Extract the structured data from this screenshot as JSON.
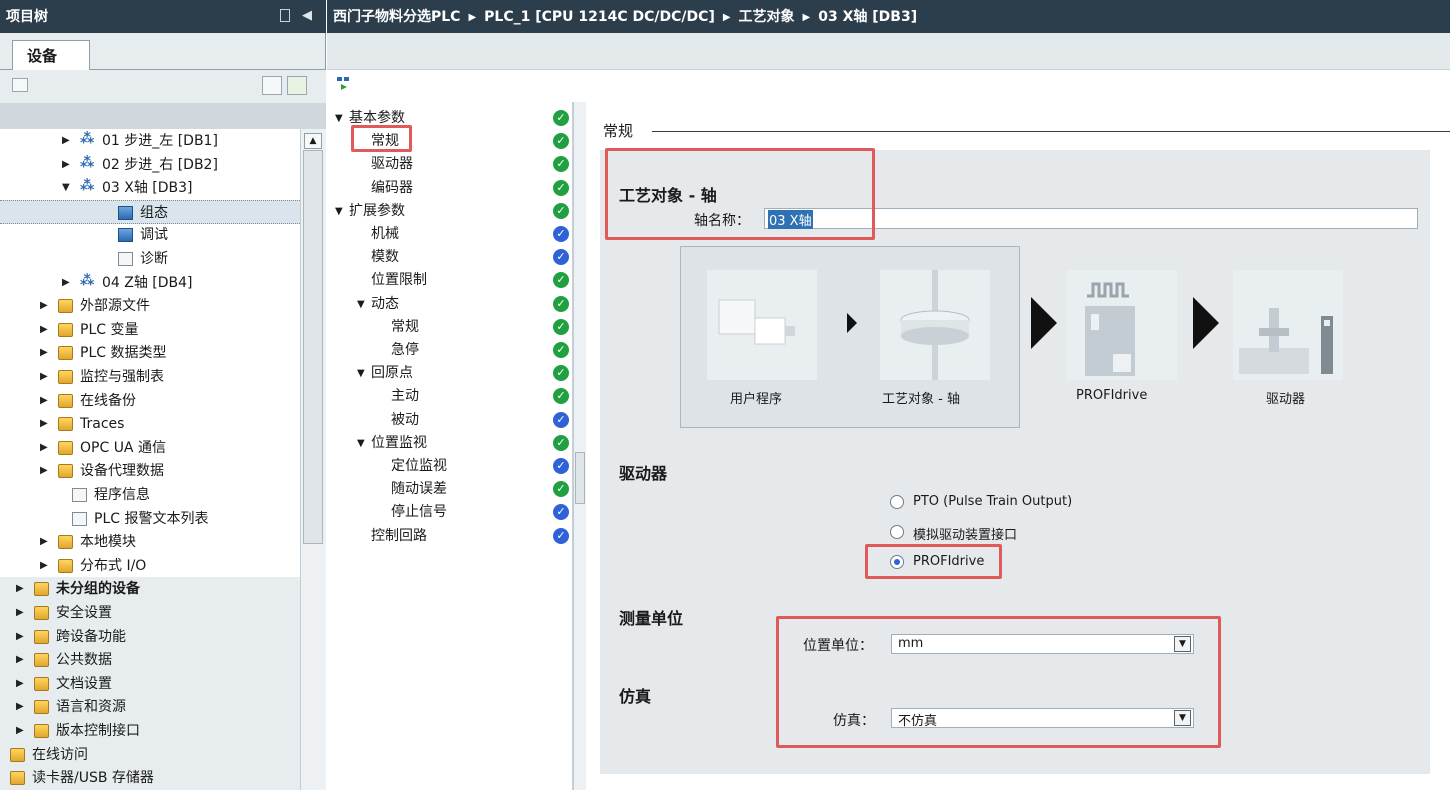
{
  "tree": {
    "title": "项目树",
    "collapse_symbol": "◀",
    "tab_label": "设备",
    "items": [
      {
        "label": "01 步进_左 [DB1]",
        "icon": "axis-icon"
      },
      {
        "label": "02 步进_右 [DB2]",
        "icon": "axis-icon"
      },
      {
        "label": "03 X轴 [DB3]",
        "icon": "axis-icon"
      },
      {
        "label": "组态",
        "icon": "config-icon"
      },
      {
        "label": "调试",
        "icon": "commissioning-icon"
      },
      {
        "label": "诊断",
        "icon": "diagnostics-icon"
      },
      {
        "label": "04 Z轴 [DB4]",
        "icon": "axis-icon"
      },
      {
        "label": "外部源文件",
        "icon": "folder-icon"
      },
      {
        "label": "PLC 变量",
        "icon": "folder-icon"
      },
      {
        "label": "PLC 数据类型",
        "icon": "folder-icon"
      },
      {
        "label": "监控与强制表",
        "icon": "folder-icon"
      },
      {
        "label": "在线备份",
        "icon": "folder-icon"
      },
      {
        "label": "Traces",
        "icon": "folder-icon"
      },
      {
        "label": "OPC UA 通信",
        "icon": "folder-icon"
      },
      {
        "label": "设备代理数据",
        "icon": "folder-icon"
      },
      {
        "label": "程序信息",
        "icon": "doc-icon"
      },
      {
        "label": "PLC 报警文本列表",
        "icon": "doc-icon"
      },
      {
        "label": "本地模块",
        "icon": "folder-icon"
      },
      {
        "label": "分布式 I/O",
        "icon": "folder-icon"
      },
      {
        "label": "未分组的设备",
        "icon": "folder-icon"
      },
      {
        "label": "安全设置",
        "icon": "folder-icon"
      },
      {
        "label": "跨设备功能",
        "icon": "folder-icon"
      },
      {
        "label": "公共数据",
        "icon": "folder-icon"
      },
      {
        "label": "文档设置",
        "icon": "folder-icon"
      },
      {
        "label": "语言和资源",
        "icon": "folder-icon"
      },
      {
        "label": "版本控制接口",
        "icon": "folder-icon"
      },
      {
        "label": "在线访问",
        "icon": "folder-icon"
      },
      {
        "label": "读卡器/USB 存储器",
        "icon": "folder-icon"
      }
    ]
  },
  "breadcrumb": [
    "西门子物料分选PLC",
    "PLC_1 [CPU 1214C DC/DC/DC]",
    "工艺对象",
    "03 X轴 [DB3]"
  ],
  "nav": {
    "items": [
      {
        "label": "基本参数",
        "status": "ok"
      },
      {
        "label": "常规",
        "status": "ok"
      },
      {
        "label": "驱动器",
        "status": "ok"
      },
      {
        "label": "编码器",
        "status": "ok"
      },
      {
        "label": "扩展参数",
        "status": "ok"
      },
      {
        "label": "机械",
        "status": "default"
      },
      {
        "label": "模数",
        "status": "default"
      },
      {
        "label": "位置限制",
        "status": "ok"
      },
      {
        "label": "动态",
        "status": "ok"
      },
      {
        "label": "常规",
        "status": "ok"
      },
      {
        "label": "急停",
        "status": "ok"
      },
      {
        "label": "回原点",
        "status": "ok"
      },
      {
        "label": "主动",
        "status": "ok"
      },
      {
        "label": "被动",
        "status": "default"
      },
      {
        "label": "位置监视",
        "status": "ok"
      },
      {
        "label": "定位监视",
        "status": "default"
      },
      {
        "label": "随动误差",
        "status": "ok"
      },
      {
        "label": "停止信号",
        "status": "default"
      },
      {
        "label": "控制回路",
        "status": "default"
      }
    ]
  },
  "content": {
    "section_title": "常规",
    "tech_object_heading": "工艺对象 - 轴",
    "axis_name_label": "轴名称：",
    "axis_name_value": "03 X轴",
    "diagram": {
      "user_program": "用户程序",
      "tech_object": "工艺对象 - 轴",
      "profidrive": "PROFIdrive",
      "drive": "驱动器"
    },
    "drive_heading": "驱动器",
    "drive_options": [
      "PTO (Pulse Train Output)",
      "模拟驱动装置接口",
      "PROFIdrive"
    ],
    "drive_selected": "PROFIdrive",
    "units_heading": "测量单位",
    "position_unit_label": "位置单位：",
    "position_unit_value": "mm",
    "simulation_heading": "仿真",
    "simulation_label": "仿真：",
    "simulation_value": "不仿真"
  },
  "colors": {
    "header_bg": "#2c3d4b",
    "ok_green": "#21a041",
    "default_blue": "#2f62d6",
    "highlight_red": "#e05a5a",
    "panel_bg": "#e5e9ec"
  }
}
